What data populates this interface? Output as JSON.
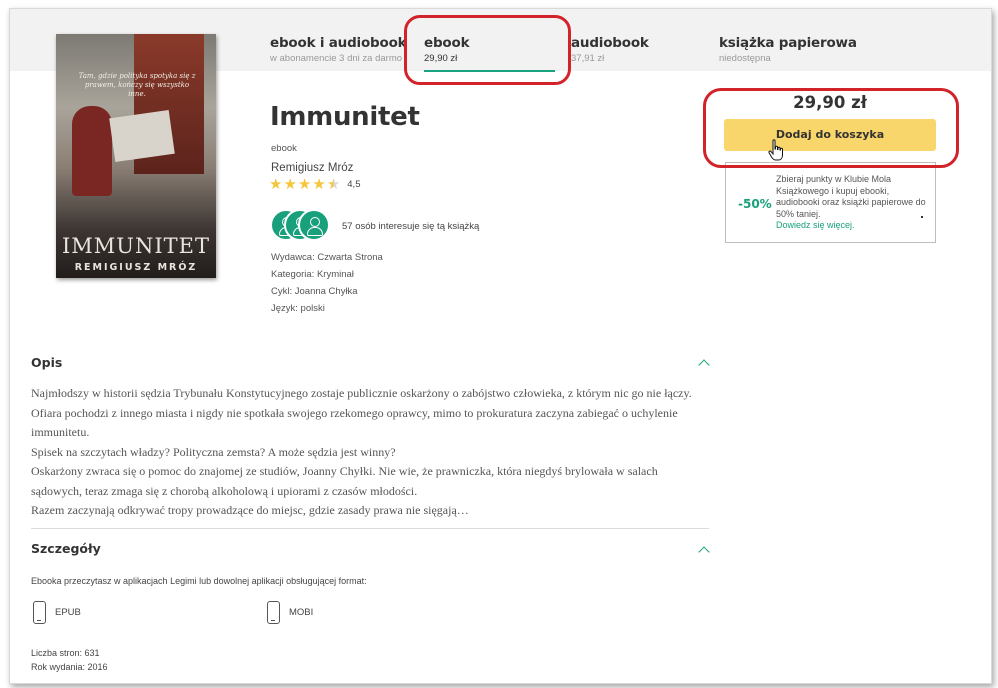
{
  "tabs": [
    {
      "title": "ebook i audiobook",
      "sub": "w abonamencie 3 dni za darmo"
    },
    {
      "title": "ebook",
      "sub": "29,90 zł"
    },
    {
      "title": "audiobook",
      "sub": "37,91 zł"
    },
    {
      "title": "książka papierowa",
      "sub": "niedostępna"
    }
  ],
  "cover": {
    "quote": "Tam, gdzie polityka spotyka się z prawem, kończy się wszystko inne.",
    "title": "IMMUNITET",
    "author": "REMIGIUSZ MRÓZ"
  },
  "book": {
    "title": "Immunitet",
    "format": "ebook",
    "author": "Remigiusz Mróz",
    "rating": 4.5,
    "rating_label": "4,5",
    "interest": "57 osób interesuje się tą książką",
    "publisher": "Wydawca: Czwarta Strona",
    "category": "Kategoria: Kryminał",
    "series": "Cykl: Joanna Chyłka",
    "language": "Język: polski"
  },
  "purchase": {
    "price": "29,90 zł",
    "cart_button": "Dodaj do koszyka"
  },
  "club": {
    "discount": "-50%",
    "text": "Zbieraj punkty w Klubie Mola Książkowego i kupuj ebooki, audiobooki oraz książki papierowe do 50% taniej.",
    "link": "Dowiedz się więcej."
  },
  "description": {
    "title": "Opis",
    "paragraphs": [
      "Najmłodszy w historii sędzia Trybunału Konstytucyjnego zostaje publicznie oskarżony o zabójstwo człowieka, z którym nic go nie łączy. Ofiara pochodzi z innego miasta i nigdy nie spotkała swojego rzekomego oprawcy, mimo to prokuratura zaczyna zabiegać o uchylenie immunitetu.",
      "Spisek na szczytach władzy? Polityczna zemsta? A może sędzia jest winny?",
      "Oskarżony zwraca się o pomoc do znajomej ze studiów, Joanny Chyłki. Nie wie, że prawniczka, która niegdyś brylowała w salach sądowych, teraz zmaga się z chorobą alkoholową i upiorami z czasów młodości.",
      "Razem zaczynają odkrywać tropy prowadzące do miejsc, gdzie zasady prawa nie sięgają…"
    ]
  },
  "details": {
    "title": "Szczegóły",
    "formats_intro": "Ebooka przeczytasz w aplikacjach Legimi lub dowolnej aplikacji obsługującej format:",
    "formats": [
      "EPUB",
      "MOBI"
    ],
    "pages": "Liczba stron: 631",
    "year": "Rok wydania: 2016"
  },
  "icons": {
    "star": "star-icon",
    "chevron": "chevron-up-icon",
    "device": "device-icon",
    "cursor": "hand-pointer-icon"
  },
  "colors": {
    "accent": "#18a07c",
    "button": "#f8d66b",
    "star": "#f4c53d",
    "annotation": "#d2232a"
  }
}
